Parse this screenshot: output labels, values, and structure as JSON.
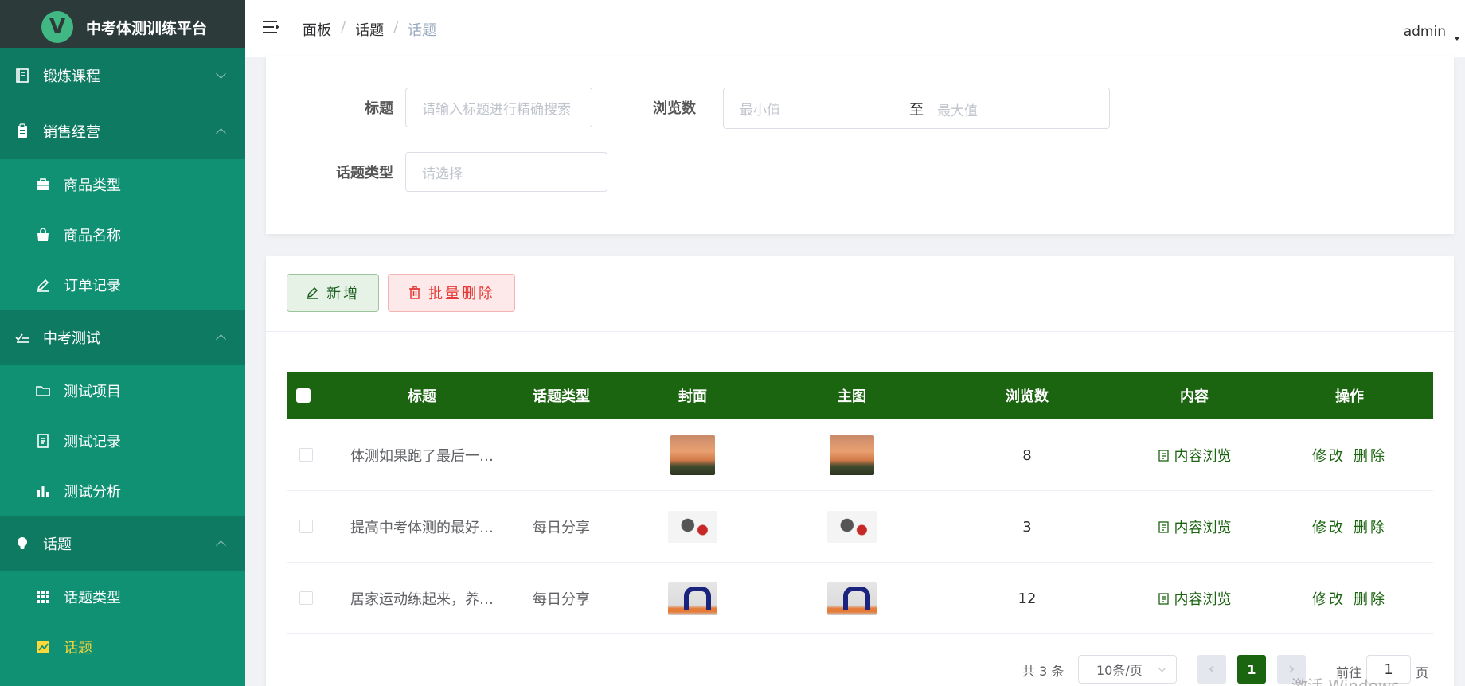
{
  "app": {
    "title": "中考体测训练平台",
    "logo_letter": "V"
  },
  "header": {
    "breadcrumb": [
      "面板",
      "话题",
      "话题"
    ],
    "breadcrumb_sep": "/",
    "user": "admin"
  },
  "sidebar": {
    "groups": [
      {
        "label": "锻炼课程",
        "icon": "book-icon",
        "expanded": false
      },
      {
        "label": "销售经营",
        "icon": "clipboard-icon",
        "expanded": true,
        "items": [
          "商品类型",
          "商品名称",
          "订单记录"
        ]
      },
      {
        "label": "中考测试",
        "icon": "checklist-icon",
        "expanded": true,
        "items": [
          "测试项目",
          "测试记录",
          "测试分析"
        ]
      },
      {
        "label": "话题",
        "icon": "bulb-icon",
        "expanded": true,
        "items": [
          "话题类型",
          "话题"
        ]
      }
    ],
    "active_item": "话题"
  },
  "search": {
    "title_label": "标题",
    "title_placeholder": "请输入标题进行精确搜索",
    "views_label": "浏览数",
    "views_min_placeholder": "最小值",
    "views_sep": "至",
    "views_max_placeholder": "最大值",
    "type_label": "话题类型",
    "type_placeholder": "请选择"
  },
  "toolbar": {
    "add_label": "新增",
    "batch_delete_label": "批量删除"
  },
  "table": {
    "columns": [
      "标题",
      "话题类型",
      "封面",
      "主图",
      "浏览数",
      "内容",
      "操作"
    ],
    "rows": [
      {
        "title": "体测如果跑了最后一…",
        "type": "",
        "cover": "sunset-photo",
        "image": "sunset-photo",
        "views": "8",
        "content": "内容浏览",
        "edit": "修改",
        "delete": "删除"
      },
      {
        "title": "提高中考体测的最好…",
        "type": "每日分享",
        "cover": "pushup-photo",
        "image": "pushup-photo",
        "views": "3",
        "content": "内容浏览",
        "edit": "修改",
        "delete": "删除"
      },
      {
        "title": "居家运动练起来，养…",
        "type": "每日分享",
        "cover": "yoga-photo",
        "image": "yoga-photo",
        "views": "12",
        "content": "内容浏览",
        "edit": "修改",
        "delete": "删除"
      }
    ]
  },
  "pagination": {
    "total": "共 3 条",
    "page_size": "10条/页",
    "current_page": "1",
    "goto_label": "前往",
    "goto_value": "1",
    "page_suffix": "页"
  },
  "watermark": "激活 Windows",
  "colors": {
    "sidebar": "#119174",
    "sidebar_group": "#0f7a62",
    "table_header": "#1b6410",
    "active": "#ffd83a"
  }
}
